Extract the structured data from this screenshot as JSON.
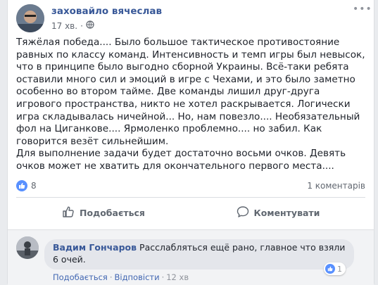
{
  "post": {
    "author": "заховайло вячеслав",
    "time": "17 хв.",
    "privacy_icon": "globe-icon",
    "more_icon": "more-dots-icon",
    "text": "Тяжёлая победа.... Было большое тактическое противостояние равных по классу команд. Интенсивность и темп игры был невысок, что в принципе было выгодно сборной Украины. Всё-таки ребята оставили много сил и эмоций в игре с Чехами, и это было заметно особенно во втором тайме. Две команды лишил друг-друга игрового пространства, никто не хотел раскрывается. Логически игра складывалась ничейной... Но, нам повезло.... Необязательный фол на Циганкове.... Ярмоленко проблемно.... но забил. Как говорится везёт сильнейшим.\nДля выполнение задачи будет достаточно восьми очков. Девять очков может не хватить для окончательного первого места....",
    "like_count": "8",
    "comment_count": "1 коментарів"
  },
  "actions": {
    "like_label": "Подобається",
    "comment_label": "Коментувати"
  },
  "comment": {
    "author": "Вадим Гончаров",
    "text": "Расслабляться ещё рано, главное что взяли 6 очей.",
    "reaction_count": "1",
    "like_label": "Подобається",
    "separator": "·",
    "reply_label": "Відповісти",
    "time": "12 хв"
  },
  "colors": {
    "link": "#385898",
    "like_badge": "#5890ff",
    "background": "#e9ebee"
  }
}
